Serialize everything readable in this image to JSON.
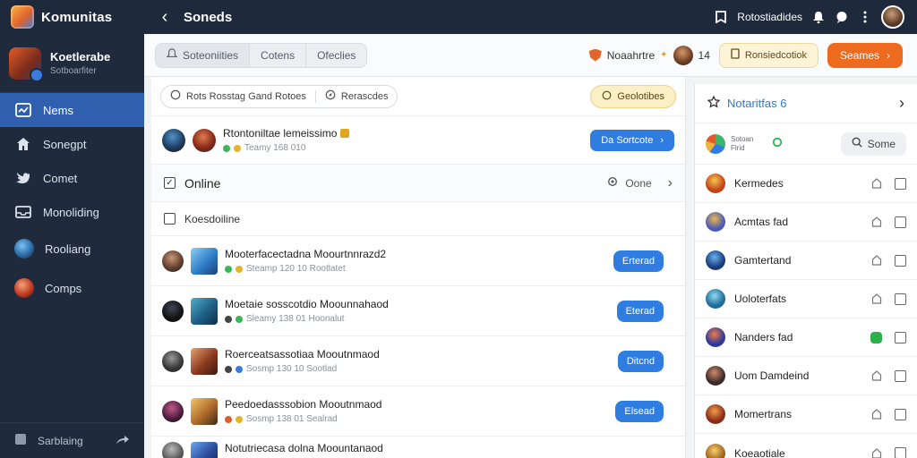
{
  "app": {
    "name": "Komunitas"
  },
  "topbar": {
    "title": "Soneds",
    "user_label": "Rotostiadides"
  },
  "sidebar": {
    "profile": {
      "name": "Koetlerabe",
      "sub": "Sotboarfiter"
    },
    "items": [
      {
        "label": "Nems",
        "icon": "news-icon",
        "active": true
      },
      {
        "label": "Sonegpt",
        "icon": "home-icon",
        "active": false
      },
      {
        "label": "Comet",
        "icon": "bird-icon",
        "active": false
      },
      {
        "label": "Monoliding",
        "icon": "inbox-icon",
        "active": false
      },
      {
        "label": "Rooliang",
        "icon": "game-avatar-icon",
        "active": false
      },
      {
        "label": "Comps",
        "icon": "game-avatar-icon",
        "active": false
      }
    ],
    "footer": {
      "label": "Sarblaing"
    }
  },
  "header": {
    "tabs": [
      "Soteoniities",
      "Cotens",
      "Ofeclies"
    ],
    "notif_label": "Noaahrtre",
    "notif_count": "14",
    "yellow_pill": "Ronsiedcotiok",
    "orange_button": "Seames"
  },
  "filters": {
    "search_label": "Rots Rosstag Gand Rotoes",
    "second_label": "Rerascdes",
    "chip_label": "Geolotibes"
  },
  "featured": {
    "title": "Rtontoniltae lemeissimo",
    "sub": "Teamy 168 010",
    "button": "Da Sortcote"
  },
  "online": {
    "title": "Online",
    "right_label": "Oone"
  },
  "subheader": {
    "label": "Koesdoiline"
  },
  "rows": [
    {
      "title": "Mooterfacectadna Moourtnnrazd2",
      "sub": "Steamp 120 10  Rootlatet",
      "button": "Erterad"
    },
    {
      "title": "Moetaie sosscotdio Moounnahaod",
      "sub": "Sleamy 138 01  Hoonalut",
      "button": "Eterad"
    },
    {
      "title": "Roerceatsassotiaa Mooutnmaod",
      "sub": "Sosmp 130 10  Sootlad",
      "button": "Ditcnd"
    },
    {
      "title": "Peedoedasssobion Mooutnmaod",
      "sub": "Sosmp 138 01  Sealrad",
      "button": "Elsead"
    },
    {
      "title": "Notutriecasa dolna Moountanaod",
      "sub": "",
      "button": ""
    }
  ],
  "right_panel": {
    "title": "Notaritfas 6",
    "logo_text": "Sotoan\nFlrid",
    "search_button": "Some",
    "items": [
      {
        "name": "Kermedes",
        "toggled": false
      },
      {
        "name": "Acmtas fad",
        "toggled": false
      },
      {
        "name": "Gamtertand",
        "toggled": false
      },
      {
        "name": "Uoloterfats",
        "toggled": false
      },
      {
        "name": "Nanders fad",
        "toggled": true
      },
      {
        "name": "Uom Damdeind",
        "toggled": false
      },
      {
        "name": "Momertrans",
        "toggled": false
      },
      {
        "name": "Koeaotiale",
        "toggled": false
      }
    ]
  },
  "colors": {
    "accent": "#2f7de1",
    "orange": "#ee6a1e",
    "sidebar": "#1f2b3c",
    "active_nav": "#2f5fae"
  }
}
